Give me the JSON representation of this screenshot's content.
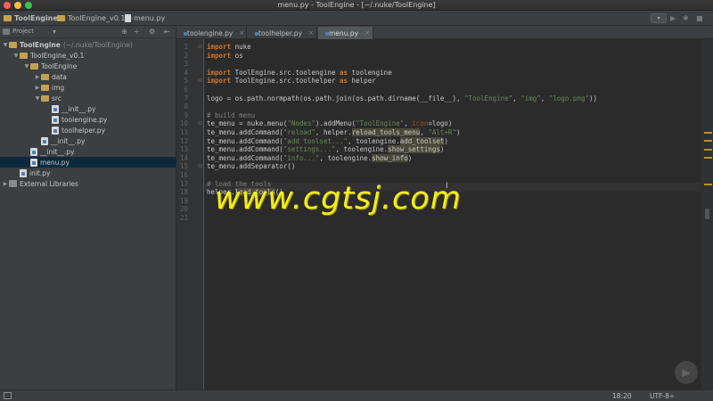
{
  "window": {
    "title": "menu.py - ToolEngine - [~/.nuke/ToolEngine]",
    "colors": {
      "close": "#fc605c",
      "minimize": "#fdbc40",
      "zoom": "#34c84a"
    }
  },
  "breadcrumbs": [
    {
      "label": "ToolEngine",
      "icon": "folder-icon"
    },
    {
      "label": "ToolEngine_v0.1",
      "icon": "folder-icon"
    },
    {
      "label": "menu.py",
      "icon": "python-file-icon"
    }
  ],
  "project_panel": {
    "header": "Project",
    "tree": [
      {
        "label": "ToolEngine",
        "suffix": "(~/.nuke/ToolEngine)",
        "type": "folder",
        "depth": 0,
        "expanded": true,
        "selected": false
      },
      {
        "label": "ToolEngine_v0.1",
        "suffix": "",
        "type": "folder",
        "depth": 1,
        "expanded": true,
        "selected": false
      },
      {
        "label": "ToolEngine",
        "suffix": "",
        "type": "folder",
        "depth": 2,
        "expanded": true,
        "selected": false
      },
      {
        "label": "data",
        "suffix": "",
        "type": "folder",
        "depth": 3,
        "expanded": false,
        "selected": false
      },
      {
        "label": "img",
        "suffix": "",
        "type": "folder",
        "depth": 3,
        "expanded": false,
        "selected": false
      },
      {
        "label": "src",
        "suffix": "",
        "type": "folder",
        "depth": 3,
        "expanded": true,
        "selected": false
      },
      {
        "label": "__init__.py",
        "suffix": "",
        "type": "file",
        "depth": 4,
        "selected": false
      },
      {
        "label": "toolengine.py",
        "suffix": "",
        "type": "file",
        "depth": 4,
        "selected": false
      },
      {
        "label": "toolhelper.py",
        "suffix": "",
        "type": "file",
        "depth": 4,
        "selected": false
      },
      {
        "label": "__init__.py",
        "suffix": "",
        "type": "file",
        "depth": 3,
        "selected": false
      },
      {
        "label": "__init__.py",
        "suffix": "",
        "type": "file",
        "depth": 2,
        "selected": false
      },
      {
        "label": "menu.py",
        "suffix": "",
        "type": "file",
        "depth": 2,
        "selected": true
      },
      {
        "label": "init.py",
        "suffix": "",
        "type": "file",
        "depth": 1,
        "selected": false
      },
      {
        "label": "External Libraries",
        "suffix": "",
        "type": "library",
        "depth": 0,
        "expanded": false,
        "selected": false
      }
    ]
  },
  "tabs": [
    {
      "label": "toolengine.py",
      "active": false
    },
    {
      "label": "toolhelper.py",
      "active": false
    },
    {
      "label": "menu.py",
      "active": true
    }
  ],
  "editor": {
    "line_numbers": [
      "1",
      "2",
      "3",
      "4",
      "5",
      "6",
      "7",
      "8",
      "9",
      "10",
      "11",
      "12",
      "13",
      "14",
      "15",
      "16",
      "17",
      "18",
      "19",
      "20",
      "21"
    ],
    "lines": [
      [
        {
          "t": "import",
          "c": "kw"
        },
        {
          "t": " nuke"
        }
      ],
      [
        {
          "t": "import",
          "c": "kw"
        },
        {
          "t": " os"
        }
      ],
      [],
      [
        {
          "t": "import",
          "c": "kw"
        },
        {
          "t": " ToolEngine.src.toolengine "
        },
        {
          "t": "as",
          "c": "kw"
        },
        {
          "t": " toolengine"
        }
      ],
      [
        {
          "t": "import",
          "c": "kw"
        },
        {
          "t": " ToolEngine.src.toolhelper "
        },
        {
          "t": "as",
          "c": "kw"
        },
        {
          "t": " helper"
        }
      ],
      [],
      [
        {
          "t": "logo = os.path.normpath(os.path.join(os.path.dirname(__file__), "
        },
        {
          "t": "\"ToolEngine\"",
          "c": "str"
        },
        {
          "t": ", "
        },
        {
          "t": "\"img\"",
          "c": "str"
        },
        {
          "t": ", "
        },
        {
          "t": "\"logo.png\"",
          "c": "str"
        },
        {
          "t": "))"
        }
      ],
      [],
      [
        {
          "t": "# build menu",
          "c": "cmt"
        }
      ],
      [
        {
          "t": "te_menu = nuke.menu("
        },
        {
          "t": "\"Nodes\"",
          "c": "str"
        },
        {
          "t": ").addMenu("
        },
        {
          "t": "\"ToolEngine\"",
          "c": "str"
        },
        {
          "t": ", "
        },
        {
          "t": "icon",
          "c": "param"
        },
        {
          "t": "=logo)"
        }
      ],
      [
        {
          "t": "te_menu.addCommand("
        },
        {
          "t": "\"reload\"",
          "c": "str"
        },
        {
          "t": ", helper."
        },
        {
          "t": "reload_tools_menu",
          "c": "hl"
        },
        {
          "t": ", "
        },
        {
          "t": "\"Alt+R\"",
          "c": "str"
        },
        {
          "t": ")"
        }
      ],
      [
        {
          "t": "te_menu.addCommand("
        },
        {
          "t": "\"add toolset...\"",
          "c": "str"
        },
        {
          "t": ", toolengine."
        },
        {
          "t": "add_toolset",
          "c": "hl"
        },
        {
          "t": ")"
        }
      ],
      [
        {
          "t": "te_menu.addCommand("
        },
        {
          "t": "\"settings...\"",
          "c": "str"
        },
        {
          "t": ", toolengine."
        },
        {
          "t": "show_settings",
          "c": "hl"
        },
        {
          "t": ")"
        }
      ],
      [
        {
          "t": "te_menu.addCommand("
        },
        {
          "t": "\"info...\"",
          "c": "str"
        },
        {
          "t": ", toolengine."
        },
        {
          "t": "show_info",
          "c": "hl"
        },
        {
          "t": ")"
        }
      ],
      [
        {
          "t": "te_menu.addSeparator()"
        }
      ],
      [],
      [
        {
          "t": "# load the tools",
          "c": "cmt"
        }
      ],
      [
        {
          "t": "helper."
        },
        {
          "t": "load_tools",
          "c": "hl"
        },
        {
          "t": "()"
        }
      ],
      [],
      [],
      []
    ]
  },
  "watermark": "www.cgtsj.com",
  "status": {
    "position": "18:20",
    "encoding": "UTF-8÷"
  },
  "icons": {
    "project_dropdown": "chevron-down-icon",
    "sync": "target-icon",
    "split": "split-icon",
    "settings": "gear-icon",
    "hide": "collapse-icon",
    "run": "play-icon",
    "debug": "bug-icon",
    "stop": "stop-icon"
  }
}
